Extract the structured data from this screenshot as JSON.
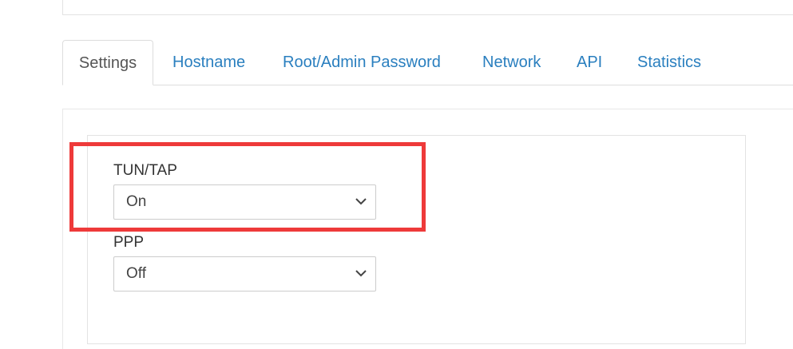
{
  "tabs": [
    {
      "label": "Settings",
      "active": true
    },
    {
      "label": "Hostname",
      "active": false
    },
    {
      "label": "Root/Admin Password",
      "active": false
    },
    {
      "label": "Network",
      "active": false
    },
    {
      "label": "API",
      "active": false
    },
    {
      "label": "Statistics",
      "active": false
    }
  ],
  "settings": {
    "tun_tap": {
      "label": "TUN/TAP",
      "value": "On"
    },
    "ppp": {
      "label": "PPP",
      "value": "Off"
    }
  },
  "colors": {
    "link": "#2a7fbf",
    "highlight": "#ee3a3a",
    "border": "#dddddd"
  },
  "icons": {
    "select_arrow": "chevron-down-icon"
  }
}
